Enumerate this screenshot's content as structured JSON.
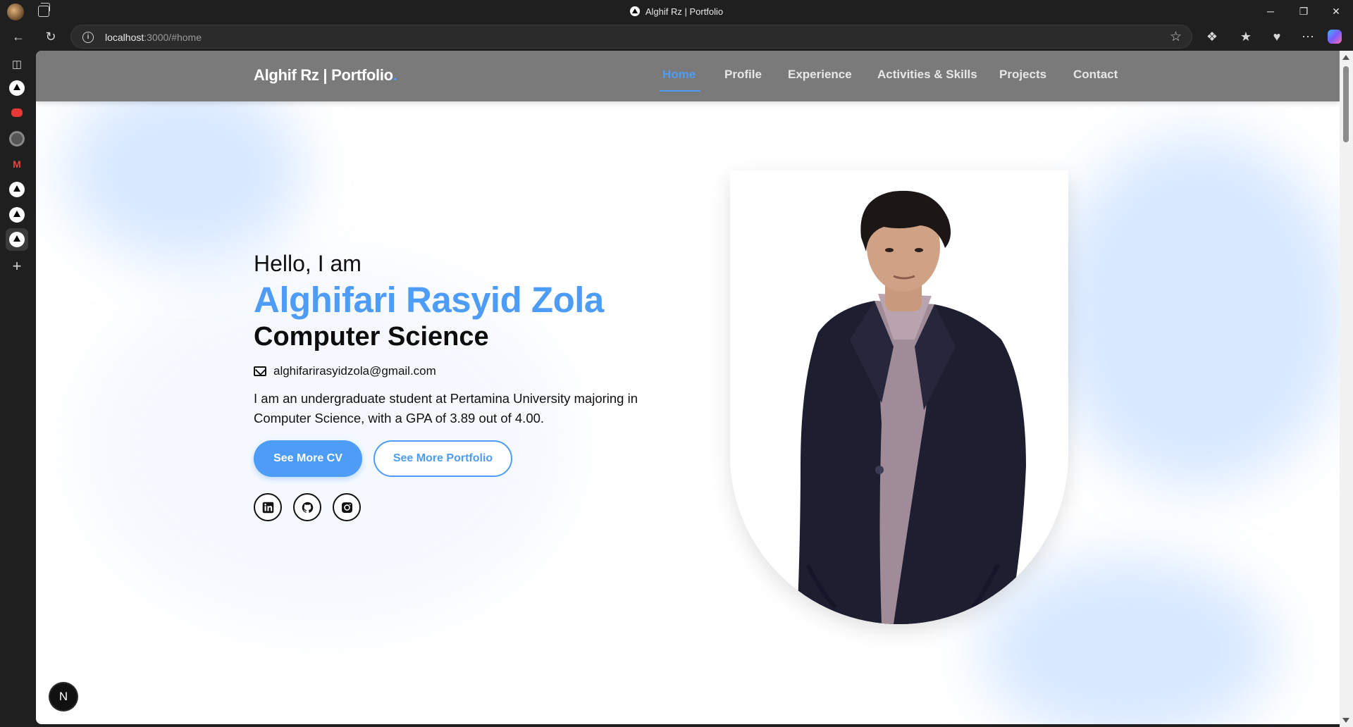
{
  "browser": {
    "tab_title": "Alghif Rz | Portfolio",
    "url_host": "localhost",
    "url_rest": ":3000/#home",
    "window_controls": [
      "─",
      "❐",
      "✕"
    ]
  },
  "navbar": {
    "brand": "Alghif Rz | Portfolio",
    "brand_dot": ".",
    "items": [
      {
        "label": "Home"
      },
      {
        "label": "Profile"
      },
      {
        "label": "Experience"
      },
      {
        "label": "Activities & Skills"
      },
      {
        "label": "Projects"
      },
      {
        "label": "Contact"
      }
    ],
    "active": "Home"
  },
  "hero": {
    "greeting": "Hello, I am",
    "name": "Alghifari Rasyid Zola",
    "role": "Computer Science",
    "email": "alghifarirasyidzola@gmail.com",
    "bio": "I am an undergraduate student at Pertamina University majoring in Computer Science, with a GPA of 3.89 out of 4.00.",
    "primary_button": "See More CV",
    "secondary_button": "See More Portfolio",
    "socials": [
      "linkedin-icon",
      "github-icon",
      "instagram-icon"
    ]
  },
  "dev_badge": "N",
  "colors": {
    "accent": "#4d9cf7",
    "navbar": "#7a7a7a",
    "text": "#111111"
  }
}
